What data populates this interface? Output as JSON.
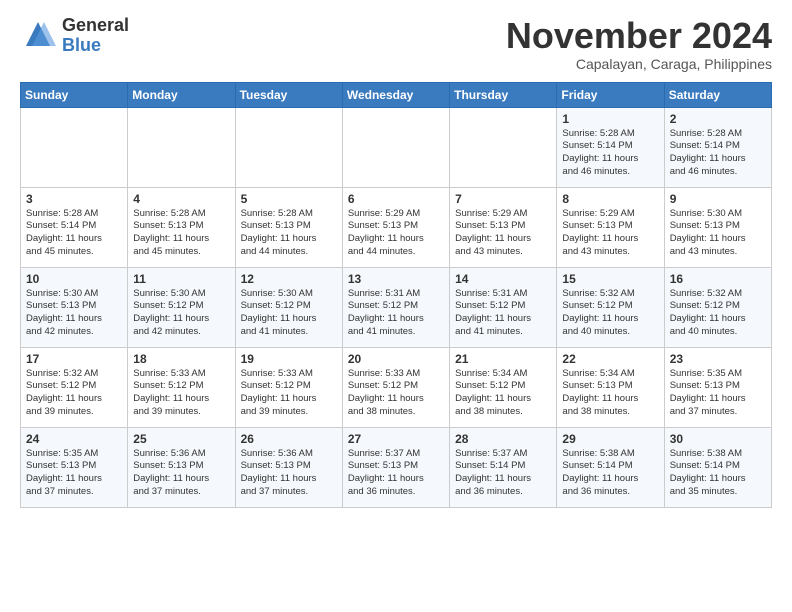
{
  "logo": {
    "general": "General",
    "blue": "Blue"
  },
  "header": {
    "month": "November 2024",
    "location": "Capalayan, Caraga, Philippines"
  },
  "weekdays": [
    "Sunday",
    "Monday",
    "Tuesday",
    "Wednesday",
    "Thursday",
    "Friday",
    "Saturday"
  ],
  "weeks": [
    [
      {
        "day": "",
        "info": ""
      },
      {
        "day": "",
        "info": ""
      },
      {
        "day": "",
        "info": ""
      },
      {
        "day": "",
        "info": ""
      },
      {
        "day": "",
        "info": ""
      },
      {
        "day": "1",
        "info": "Sunrise: 5:28 AM\nSunset: 5:14 PM\nDaylight: 11 hours\nand 46 minutes."
      },
      {
        "day": "2",
        "info": "Sunrise: 5:28 AM\nSunset: 5:14 PM\nDaylight: 11 hours\nand 46 minutes."
      }
    ],
    [
      {
        "day": "3",
        "info": "Sunrise: 5:28 AM\nSunset: 5:14 PM\nDaylight: 11 hours\nand 45 minutes."
      },
      {
        "day": "4",
        "info": "Sunrise: 5:28 AM\nSunset: 5:13 PM\nDaylight: 11 hours\nand 45 minutes."
      },
      {
        "day": "5",
        "info": "Sunrise: 5:28 AM\nSunset: 5:13 PM\nDaylight: 11 hours\nand 44 minutes."
      },
      {
        "day": "6",
        "info": "Sunrise: 5:29 AM\nSunset: 5:13 PM\nDaylight: 11 hours\nand 44 minutes."
      },
      {
        "day": "7",
        "info": "Sunrise: 5:29 AM\nSunset: 5:13 PM\nDaylight: 11 hours\nand 43 minutes."
      },
      {
        "day": "8",
        "info": "Sunrise: 5:29 AM\nSunset: 5:13 PM\nDaylight: 11 hours\nand 43 minutes."
      },
      {
        "day": "9",
        "info": "Sunrise: 5:30 AM\nSunset: 5:13 PM\nDaylight: 11 hours\nand 43 minutes."
      }
    ],
    [
      {
        "day": "10",
        "info": "Sunrise: 5:30 AM\nSunset: 5:13 PM\nDaylight: 11 hours\nand 42 minutes."
      },
      {
        "day": "11",
        "info": "Sunrise: 5:30 AM\nSunset: 5:12 PM\nDaylight: 11 hours\nand 42 minutes."
      },
      {
        "day": "12",
        "info": "Sunrise: 5:30 AM\nSunset: 5:12 PM\nDaylight: 11 hours\nand 41 minutes."
      },
      {
        "day": "13",
        "info": "Sunrise: 5:31 AM\nSunset: 5:12 PM\nDaylight: 11 hours\nand 41 minutes."
      },
      {
        "day": "14",
        "info": "Sunrise: 5:31 AM\nSunset: 5:12 PM\nDaylight: 11 hours\nand 41 minutes."
      },
      {
        "day": "15",
        "info": "Sunrise: 5:32 AM\nSunset: 5:12 PM\nDaylight: 11 hours\nand 40 minutes."
      },
      {
        "day": "16",
        "info": "Sunrise: 5:32 AM\nSunset: 5:12 PM\nDaylight: 11 hours\nand 40 minutes."
      }
    ],
    [
      {
        "day": "17",
        "info": "Sunrise: 5:32 AM\nSunset: 5:12 PM\nDaylight: 11 hours\nand 39 minutes."
      },
      {
        "day": "18",
        "info": "Sunrise: 5:33 AM\nSunset: 5:12 PM\nDaylight: 11 hours\nand 39 minutes."
      },
      {
        "day": "19",
        "info": "Sunrise: 5:33 AM\nSunset: 5:12 PM\nDaylight: 11 hours\nand 39 minutes."
      },
      {
        "day": "20",
        "info": "Sunrise: 5:33 AM\nSunset: 5:12 PM\nDaylight: 11 hours\nand 38 minutes."
      },
      {
        "day": "21",
        "info": "Sunrise: 5:34 AM\nSunset: 5:12 PM\nDaylight: 11 hours\nand 38 minutes."
      },
      {
        "day": "22",
        "info": "Sunrise: 5:34 AM\nSunset: 5:13 PM\nDaylight: 11 hours\nand 38 minutes."
      },
      {
        "day": "23",
        "info": "Sunrise: 5:35 AM\nSunset: 5:13 PM\nDaylight: 11 hours\nand 37 minutes."
      }
    ],
    [
      {
        "day": "24",
        "info": "Sunrise: 5:35 AM\nSunset: 5:13 PM\nDaylight: 11 hours\nand 37 minutes."
      },
      {
        "day": "25",
        "info": "Sunrise: 5:36 AM\nSunset: 5:13 PM\nDaylight: 11 hours\nand 37 minutes."
      },
      {
        "day": "26",
        "info": "Sunrise: 5:36 AM\nSunset: 5:13 PM\nDaylight: 11 hours\nand 37 minutes."
      },
      {
        "day": "27",
        "info": "Sunrise: 5:37 AM\nSunset: 5:13 PM\nDaylight: 11 hours\nand 36 minutes."
      },
      {
        "day": "28",
        "info": "Sunrise: 5:37 AM\nSunset: 5:14 PM\nDaylight: 11 hours\nand 36 minutes."
      },
      {
        "day": "29",
        "info": "Sunrise: 5:38 AM\nSunset: 5:14 PM\nDaylight: 11 hours\nand 36 minutes."
      },
      {
        "day": "30",
        "info": "Sunrise: 5:38 AM\nSunset: 5:14 PM\nDaylight: 11 hours\nand 35 minutes."
      }
    ]
  ]
}
